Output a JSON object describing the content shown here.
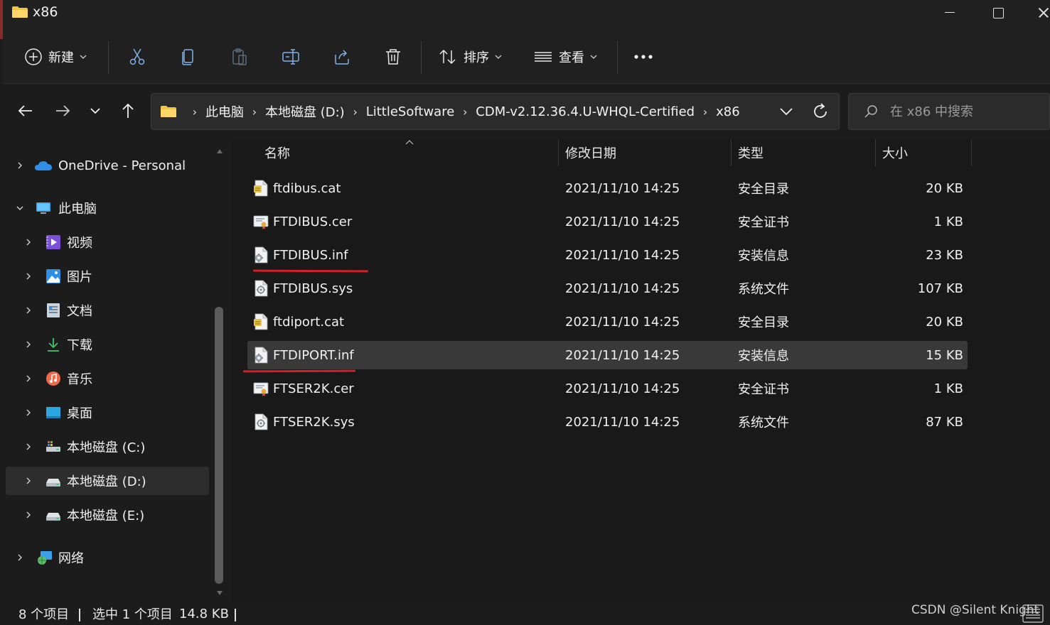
{
  "window": {
    "title": "x86"
  },
  "toolbar": {
    "new_label": "新建",
    "sort_label": "排序",
    "view_label": "查看"
  },
  "address": {
    "crumbs": [
      "此电脑",
      "本地磁盘 (D:)",
      "LittleSoftware",
      "CDM-v2.12.36.4.U-WHQL-Certified",
      "x86"
    ]
  },
  "search": {
    "placeholder": "在 x86 中搜索"
  },
  "sidebar": {
    "items": [
      {
        "label": "OneDrive - Personal",
        "icon": "onedrive-cloud-icon"
      },
      {
        "label": "此电脑",
        "icon": "this-pc-icon"
      },
      {
        "label": "视频",
        "icon": "videos-icon"
      },
      {
        "label": "图片",
        "icon": "pictures-icon"
      },
      {
        "label": "文档",
        "icon": "documents-icon"
      },
      {
        "label": "下载",
        "icon": "downloads-icon"
      },
      {
        "label": "音乐",
        "icon": "music-icon"
      },
      {
        "label": "桌面",
        "icon": "desktop-icon"
      },
      {
        "label": "本地磁盘 (C:)",
        "icon": "drive-c-icon"
      },
      {
        "label": "本地磁盘 (D:)",
        "icon": "drive-d-icon"
      },
      {
        "label": "本地磁盘 (E:)",
        "icon": "drive-e-icon"
      },
      {
        "label": "网络",
        "icon": "network-icon"
      }
    ]
  },
  "columns": {
    "name": "名称",
    "date": "修改日期",
    "type": "类型",
    "size": "大小"
  },
  "files": [
    {
      "name": "ftdibus.cat",
      "date": "2021/11/10 14:25",
      "type": "安全目录",
      "size": "20 KB",
      "icon": "catalog-file-icon"
    },
    {
      "name": "FTDIBUS.cer",
      "date": "2021/11/10 14:25",
      "type": "安全证书",
      "size": "1 KB",
      "icon": "certificate-file-icon"
    },
    {
      "name": "FTDIBUS.inf",
      "date": "2021/11/10 14:25",
      "type": "安装信息",
      "size": "23 KB",
      "icon": "setup-info-file-icon"
    },
    {
      "name": "FTDIBUS.sys",
      "date": "2021/11/10 14:25",
      "type": "系统文件",
      "size": "107 KB",
      "icon": "system-file-icon"
    },
    {
      "name": "ftdiport.cat",
      "date": "2021/11/10 14:25",
      "type": "安全目录",
      "size": "20 KB",
      "icon": "catalog-file-icon"
    },
    {
      "name": "FTDIPORT.inf",
      "date": "2021/11/10 14:25",
      "type": "安装信息",
      "size": "15 KB",
      "icon": "setup-info-file-icon"
    },
    {
      "name": "FTSER2K.cer",
      "date": "2021/11/10 14:25",
      "type": "安全证书",
      "size": "1 KB",
      "icon": "certificate-file-icon"
    },
    {
      "name": "FTSER2K.sys",
      "date": "2021/11/10 14:25",
      "type": "系统文件",
      "size": "87 KB",
      "icon": "system-file-icon"
    }
  ],
  "status": {
    "count": "8 个项目",
    "selection": "选中 1 个项目",
    "selection_size": "14.8 KB"
  },
  "watermark": "CSDN @Silent Knight",
  "colors": {
    "accent_folder": "#f4c542",
    "annotation_red": "#d1202a",
    "selected_row": "#393939"
  }
}
